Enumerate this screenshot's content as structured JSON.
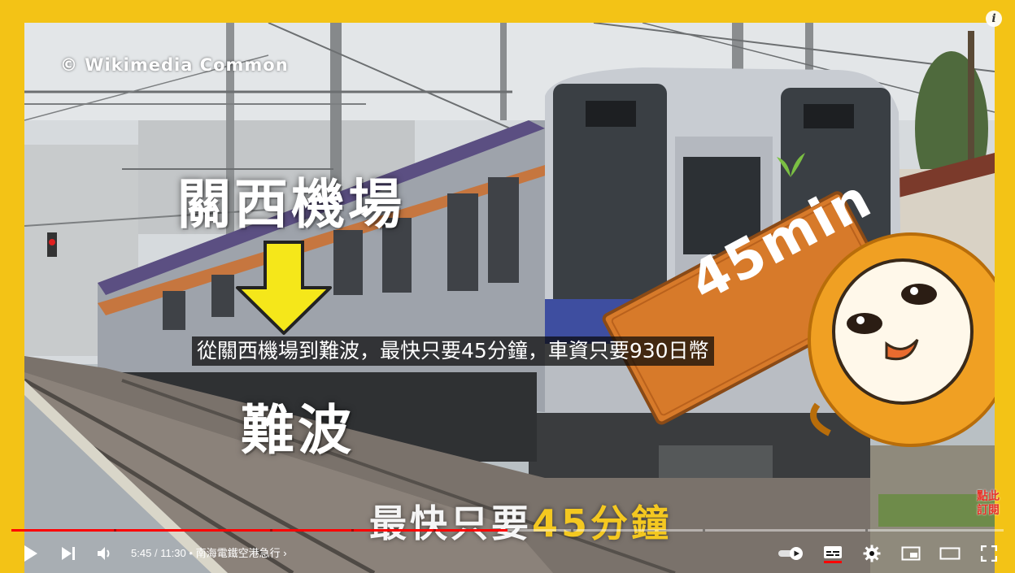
{
  "video": {
    "watermark": "© Wikimedia Common",
    "label_from": "關西機場",
    "label_to": "難波",
    "sign_text": "45min",
    "subtitle": "從關西機場到難波，最快只要45分鐘，車資只要930日幣",
    "bottom_text_prefix": "最快只要",
    "bottom_text_highlight": "45分鐘"
  },
  "player": {
    "info_icon": "i",
    "subscribe_line1": "點此",
    "subscribe_line2": "訂閱",
    "current_time": "5:45",
    "duration": "11:30",
    "time_separator": "/",
    "chapter_bullet": "•",
    "chapter_title": "南海電鐵空港急行",
    "chapter_chevron": "›",
    "progress_fraction": 0.5,
    "icons": [
      "play-icon",
      "next-icon",
      "volume-icon",
      "autoplay-toggle",
      "subtitles-icon",
      "settings-icon",
      "miniplayer-icon",
      "theater-mode-icon",
      "fullscreen-icon"
    ],
    "colors": {
      "frame": "#f3c316",
      "progress": "#ff0000",
      "subtitle_bg": "rgba(8,8,8,0.72)",
      "highlight": "#f4c820"
    }
  }
}
